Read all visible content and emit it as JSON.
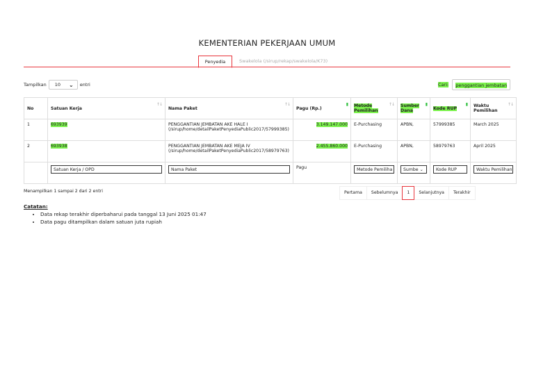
{
  "page": {
    "title": "KEMENTERIAN PEKERJAAN UMUM"
  },
  "tabs": [
    {
      "label": "Penyedia",
      "active": true
    },
    {
      "label": "Swakelola (/sirup/rekap/swakelola/K73)",
      "active": false
    }
  ],
  "length_control": {
    "prefix": "Tampilkan",
    "value": "10",
    "suffix": "entri"
  },
  "search": {
    "label": "Cari:",
    "value": "penggantian jembatan"
  },
  "table": {
    "headers": [
      "No",
      "Satuan Kerja",
      "Nama Paket",
      "Pagu (Rp.)",
      "Metode Pemilihan",
      "Sumber Dana",
      "Kode RUP",
      "Waktu Pemilihan"
    ],
    "rows": [
      {
        "no": "1",
        "satuan_kerja": "693939",
        "nama_paket": "PENGGANTIAN JEMBATAN AKE HALE I",
        "nama_paket_link": "(/sirup/home/detailPaketPenyediaPublic2017/57999385)",
        "pagu": "3.149.147.000",
        "metode": "E-Purchasing",
        "sumber": "APBN,",
        "kode_rup": "57999385",
        "waktu": "March 2025"
      },
      {
        "no": "2",
        "satuan_kerja": "693938",
        "nama_paket": "PENGGANTIAN JEMBATAN AKE MEJA IV",
        "nama_paket_link": "(/sirup/home/detailPaketPenyediaPublic2017/58979763)",
        "pagu": "2.455.860.000",
        "metode": "E-Purchasing",
        "sumber": "APBN,",
        "kode_rup": "58979763",
        "waktu": "April 2025"
      }
    ],
    "footer_filters": {
      "satuan_kerja": "Satuan Kerja / OPD",
      "nama_paket": "Nama Paket",
      "pagu": "Pagu",
      "metode": "Metode Pemiliha",
      "sumber": "Sumbe",
      "kode_rup": "Kode RUP",
      "waktu": "Waktu Pemilihan"
    }
  },
  "info": "Menampilkan 1 sampai 2 dari 2 entri",
  "pagination": {
    "first": "Pertama",
    "prev": "Sebelumnya",
    "current": "1",
    "next": "Selanjutnya",
    "last": "Terakhir"
  },
  "notes": {
    "heading": "Catatan:",
    "items": [
      "Data rekap terakhir diperbaharui pada tanggal 13 Juni 2025 01:47",
      "Data pagu ditampilkan dalam satuan juta rupiah"
    ]
  }
}
